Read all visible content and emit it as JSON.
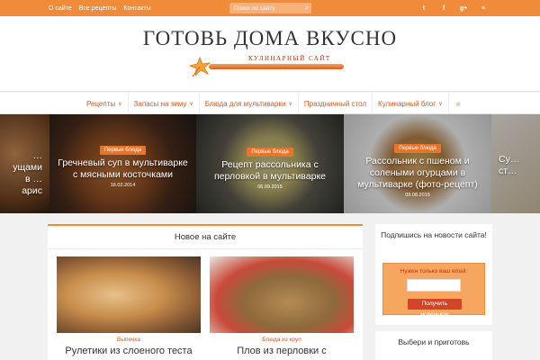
{
  "topbar": {
    "links": [
      "О сайте",
      "Все рецепты",
      "Контакты"
    ],
    "search_placeholder": "Поиск по сайту",
    "social": [
      "twitter-icon",
      "facebook-icon",
      "google-plus-icon",
      "rss-icon"
    ]
  },
  "header": {
    "title": "ГОТОВЬ ДОМА ВКУСНО",
    "subtitle": "КУЛИНАРНЫЙ САЙТ"
  },
  "nav": {
    "items": [
      {
        "label": "Рецепты",
        "has_dropdown": true
      },
      {
        "label": "Запасы на зиму",
        "has_dropdown": true
      },
      {
        "label": "Блюда для мультиварки",
        "has_dropdown": true
      },
      {
        "label": "Праздничный стол",
        "has_dropdown": false
      },
      {
        "label": "Кулинарный блог",
        "has_dropdown": true
      }
    ]
  },
  "slider": [
    {
      "category": "",
      "title": "…ущами в …арис",
      "date": ""
    },
    {
      "category": "Первые блюда",
      "title": "Гречневый суп в мультиварке с мясными косточками",
      "date": "16.02.2014"
    },
    {
      "category": "Первые блюда",
      "title": "Рецепт рассольника с перловкой в мультиварке",
      "date": "06.09.2015"
    },
    {
      "category": "Первые блюда",
      "title": "Рассольник с пшеном и солеными огурцами в мультиварке (фото-рецепт)",
      "date": "09.08.2015"
    },
    {
      "category": "",
      "title": "Су… ст…",
      "date": ""
    }
  ],
  "main": {
    "heading": "Новое на сайте",
    "cards": [
      {
        "category": "Выпечка",
        "title": "Рулетики из слоеного теста"
      },
      {
        "category": "Блюда из круп",
        "title": "Плов из перловки с"
      }
    ]
  },
  "sidebar": {
    "subscribe_title": "Подпишись на новости сайта!",
    "email_label": "Нужен только ваш email:",
    "subscribe_button": "Получить новенькое",
    "choose_title": "Выбери и приготовь"
  },
  "colors": {
    "accent": "#f08b3a",
    "link": "#d25a1e",
    "badge": "#e8742c",
    "button": "#d24528"
  }
}
